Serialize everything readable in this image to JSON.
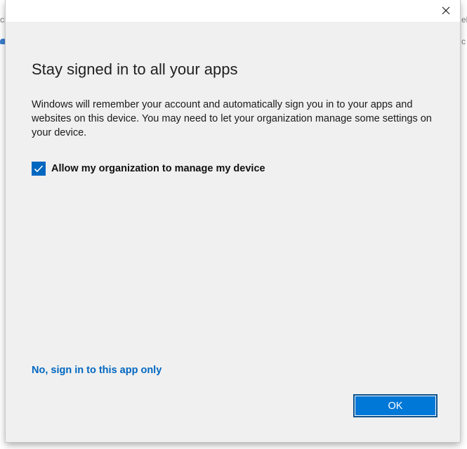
{
  "background": {
    "fragment_left": "ch",
    "fragment_right_top": "el",
    "fragment_right_mid": "c"
  },
  "dialog": {
    "close_icon": "close-icon",
    "heading": "Stay signed in to all your apps",
    "body": "Windows will remember your account and automatically sign you in to your apps and websites on this device. You may need to let your organization manage some settings on your device.",
    "checkbox": {
      "label": "Allow my organization to manage my device",
      "checked": true,
      "icon": "checkmark-icon"
    },
    "link_label": "No, sign in to this app only",
    "ok_label": "OK"
  },
  "colors": {
    "accent": "#0078d7",
    "link": "#0067c0",
    "dialog_bg": "#f0f0f0"
  }
}
